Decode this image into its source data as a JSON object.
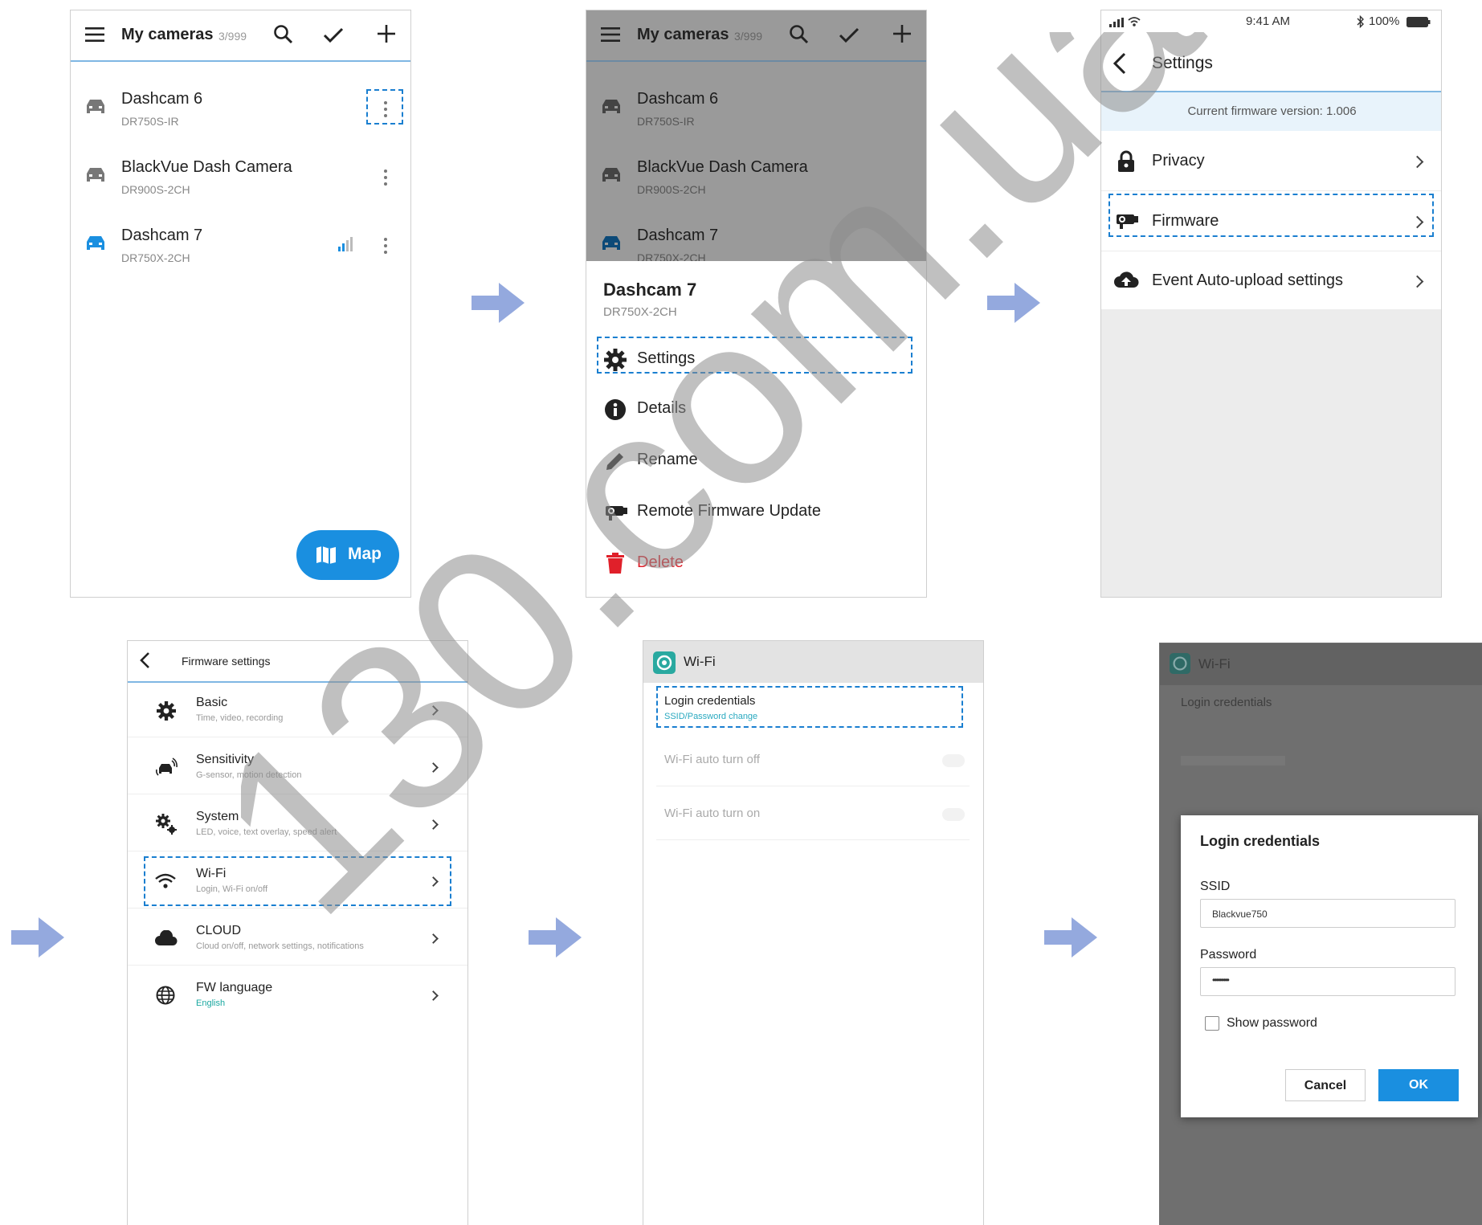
{
  "screen1": {
    "title": "My cameras",
    "count": "3/999",
    "cameras": [
      {
        "name": "Dashcam 6",
        "model": "DR750S-IR"
      },
      {
        "name": "BlackVue Dash Camera",
        "model": "DR900S-2CH"
      },
      {
        "name": "Dashcam 7",
        "model": "DR750X-2CH"
      }
    ],
    "map_label": "Map"
  },
  "screen2": {
    "title": "My cameras",
    "count": "3/999",
    "cameras": [
      {
        "name": "Dashcam 6",
        "model": "DR750S-IR"
      },
      {
        "name": "BlackVue Dash Camera",
        "model": "DR900S-2CH"
      },
      {
        "name": "Dashcam 7",
        "model": "DR750X-2CH"
      }
    ],
    "sheet_title": "Dashcam 7",
    "sheet_model": "DR750X-2CH",
    "menu": [
      "Settings",
      "Details",
      "Rename",
      "Remote Firmware Update",
      "Delete"
    ]
  },
  "screen3": {
    "status_time": "9:41 AM",
    "battery": "100%",
    "title": "Settings",
    "firmware_banner": "Current firmware version: 1.006",
    "items": [
      "Privacy",
      "Firmware",
      "Event Auto-upload settings"
    ]
  },
  "screen4": {
    "title": "Firmware settings",
    "items": [
      {
        "label": "Basic",
        "sub": "Time, video, recording"
      },
      {
        "label": "Sensitivity",
        "sub": "G-sensor, motion detection"
      },
      {
        "label": "System",
        "sub": "LED, voice, text overlay, speed alert"
      },
      {
        "label": "Wi-Fi",
        "sub": "Login, Wi-Fi on/off"
      },
      {
        "label": "CLOUD",
        "sub": "Cloud on/off, network settings, notifications"
      },
      {
        "label": "FW language",
        "sub": "English"
      }
    ]
  },
  "screen5": {
    "title": "Wi-Fi",
    "login_label": "Login credentials",
    "login_sub": "SSID/Password change",
    "auto_off": "Wi-Fi auto turn off",
    "auto_on": "Wi-Fi auto turn on"
  },
  "screen6": {
    "title": "Wi-Fi",
    "bg_login": "Login credentials",
    "dialog_title": "Login credentials",
    "ssid_label": "SSID",
    "ssid_value": "Blackvue750",
    "password_label": "Password",
    "password_value": "•••••••••",
    "show_password": "Show password",
    "cancel": "Cancel",
    "ok": "OK"
  },
  "watermark": "130.com.ua",
  "colors": {
    "accent": "#1a7fd0",
    "map_button": "#1a8fe0",
    "delete": "#e0202a",
    "arrow": "#94a9de",
    "ok_button": "#1a8fe0"
  }
}
